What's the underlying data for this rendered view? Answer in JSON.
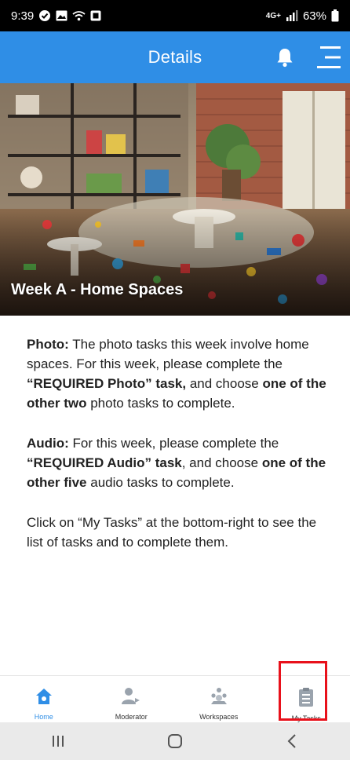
{
  "status_bar": {
    "time": "9:39",
    "left_icons": [
      "check-badge-icon",
      "image-icon",
      "wifi-calling-icon",
      "screen-icon"
    ],
    "signal": "4G+",
    "battery_percent": "63%"
  },
  "header": {
    "title": "Details",
    "bell_icon": "bell-icon",
    "menu_icon": "menu-icon"
  },
  "hero": {
    "title": "Week A - Home Spaces"
  },
  "content": {
    "photo": {
      "label": "Photo:",
      "text1": " The photo tasks this week involve home spaces. For this week, please complete the ",
      "required": "“REQUIRED Photo” task,",
      "text2": " and choose ",
      "choose": "one of the other two",
      "text3": " photo tasks to complete."
    },
    "audio": {
      "label": "Audio:",
      "text1": " For this week, please complete the ",
      "required": "“REQUIRED Audio” task",
      "text2": ", and choose ",
      "choose": "one of the other five",
      "text3": " audio tasks to complete."
    },
    "instruction": "Click on “My Tasks” at the bottom-right to see the list of tasks and to complete them."
  },
  "bottom_nav": {
    "items": [
      {
        "label": "Home",
        "icon": "home-icon",
        "active": true
      },
      {
        "label": "Moderator",
        "icon": "moderator-icon",
        "active": false
      },
      {
        "label": "Workspaces",
        "icon": "workspaces-icon",
        "active": false
      },
      {
        "label": "My Tasks",
        "icon": "clipboard-icon",
        "active": false
      }
    ]
  },
  "system_nav": {
    "recents": "recents-icon",
    "home": "home-circle-icon",
    "back": "back-icon"
  },
  "colors": {
    "accent": "#2f8ee6",
    "highlight": "#e8111b"
  }
}
